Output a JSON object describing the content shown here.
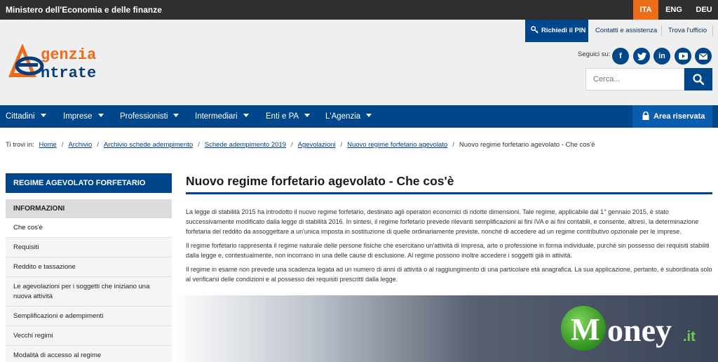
{
  "topbar": {
    "ministry": "Ministero dell'Economia e delle finanze",
    "languages": [
      {
        "label": "ITA",
        "active": true
      },
      {
        "label": "ENG",
        "active": false
      },
      {
        "label": "DEU",
        "active": false
      }
    ]
  },
  "header": {
    "logo_line1": "genzia",
    "logo_line2": "ntrate",
    "pin_button": "Richiedi il PIN",
    "links": [
      "Contatti e assistenza",
      "Trova l'ufficio"
    ],
    "social_label": "Seguici su:",
    "social": [
      "facebook-icon",
      "twitter-icon",
      "linkedin-icon",
      "youtube-icon",
      "email-icon"
    ],
    "search_placeholder": "Cerca..."
  },
  "nav": {
    "items": [
      "Cittadini",
      "Imprese",
      "Professionisti",
      "Intermediari",
      "Enti e PA",
      "L'Agenzia"
    ],
    "reserved": "Area riservata"
  },
  "breadcrumb": {
    "prefix": "Ti trovi in:",
    "links": [
      "Home",
      "Archivio",
      "Archivio schede adempimento",
      "Schede adempimento 2019",
      "Agevolazioni",
      "Nuovo regime forfetario agevolato"
    ],
    "current": "Nuovo regime forfetario agevolato - Che cos'è"
  },
  "sidebar": {
    "title": "REGIME AGEVOLATO FORFETARIO",
    "section": "INFORMAZIONI",
    "items": [
      {
        "label": "Che cos'è",
        "active": true
      },
      {
        "label": "Requisiti",
        "active": false
      },
      {
        "label": "Reddito e tassazione",
        "active": false
      },
      {
        "label": "Le agevolazioni per i soggetti che iniziano una nuova attività",
        "active": false
      },
      {
        "label": "Semplificazioni e adempimenti",
        "active": false
      },
      {
        "label": "Vecchi regimi",
        "active": false
      },
      {
        "label": "Modalità di accesso al regime",
        "active": false
      }
    ]
  },
  "main": {
    "title": "Nuovo regime forfetario agevolato - Che cos'è",
    "paragraphs": [
      "La legge di stabilità 2015 ha introdotto il nuovo regime forfetario, destinato agli operatori economici di ridotte dimensioni. Tale regime, applicabile dal 1° gennaio 2015, è stato successivamente modificato dalla legge di stabilità 2016. In sintesi, il regime forfetario prevede rilevanti semplificazioni ai fini IVA e ai fini contabili, e consente, altresì, la determinazione forfetaria del reddito da assoggettare a un'unica imposta in sostituzione di quelle ordinariamente previste, nonché di accedere ad un regime contributivo opzionale per le imprese.",
      "Il regime forfetario rappresenta il regime naturale delle persone fisiche che esercitano un'attività di impresa, arte o professione in forma individuale, purché sin possesso dei requisiti stabiliti dalla legge e, contestualmente, non incorrano in una delle cause di esclusione. Al regime possono inoltre accedere i soggetti già in attività.",
      "Il regime in esame non prevede una scadenza legata ad un numero di anni di attività o al raggiungimento di una particolare età anagrafica. La sua applicazione, pertanto, è subordinata solo al verificarsi delle condizioni e al possesso dei requisiti prescritti dalla legge."
    ]
  },
  "watermark": {
    "brand": "oney",
    "suffix": ".it",
    "letter": "M"
  },
  "colors": {
    "brand_blue": "#00468b",
    "accent_orange": "#ec6c18",
    "money_green": "#3fae29"
  }
}
